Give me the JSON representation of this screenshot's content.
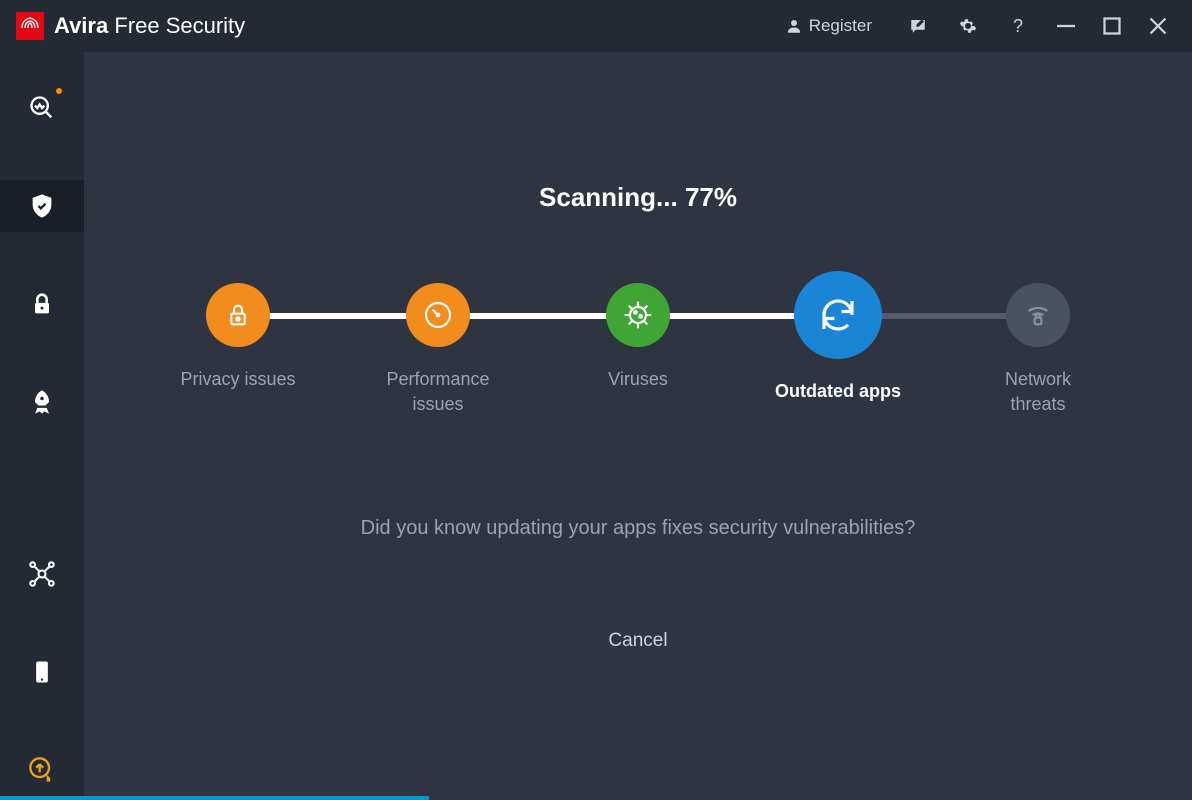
{
  "brand": {
    "name": "Avira",
    "suite": "Free Security"
  },
  "titlebar": {
    "register": "Register"
  },
  "scan": {
    "title_prefix": "Scanning... ",
    "percent": "77%",
    "steps": {
      "privacy": "Privacy issues",
      "performance": "Performance\nissues",
      "viruses": "Viruses",
      "outdated": "Outdated apps",
      "network": "Network\nthreats"
    },
    "tip": "Did you know updating your apps fixes security vulnerabilities?",
    "cancel": "Cancel"
  },
  "colors": {
    "orange": "#f28c1c",
    "green": "#3fa535",
    "blue": "#1a84d6",
    "gray": "#4a525e",
    "accent": "#0099cc"
  }
}
